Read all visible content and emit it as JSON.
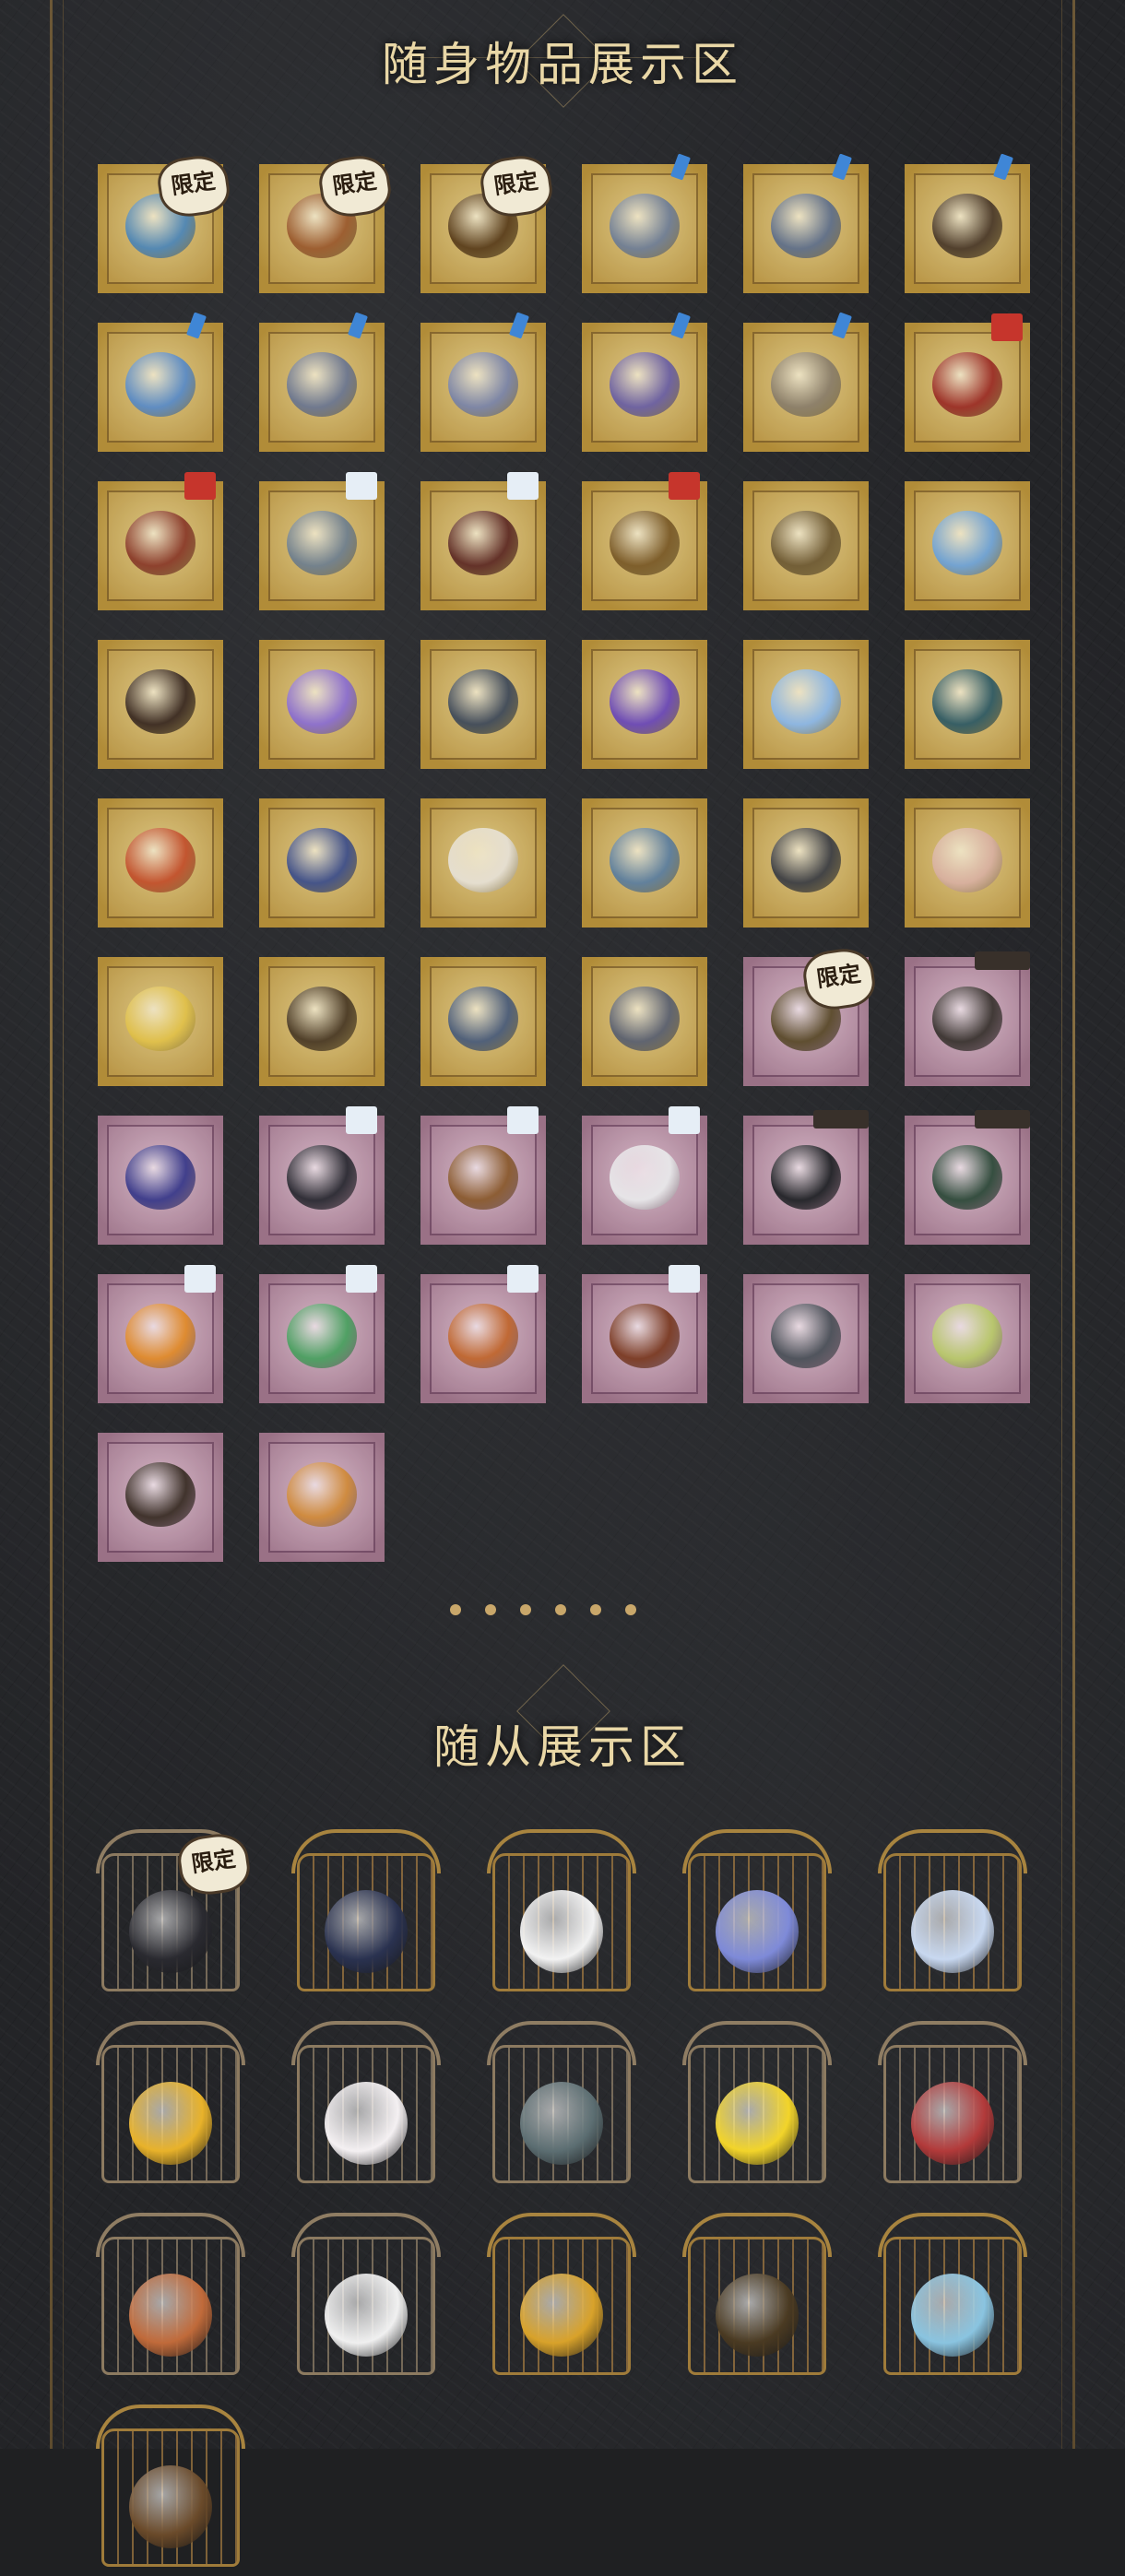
{
  "sections": {
    "carry_items": {
      "title": "随身物品展示区"
    },
    "followers": {
      "title": "随从展示区"
    }
  },
  "labels": {
    "limited": "限定"
  },
  "colors": {
    "gold_stamp": "#c6a64e",
    "purple_stamp": "#b78fa6",
    "title_text": "#e9d7a6",
    "accent_dot": "#c9a76a"
  },
  "stamps": [
    {
      "tier": "gold",
      "badge": "限定",
      "color": "#4e86b6",
      "icon": "bird-icon"
    },
    {
      "tier": "gold",
      "badge": "限定",
      "color": "#9a5a2e",
      "icon": "scroll-icon"
    },
    {
      "tier": "gold",
      "badge": "限定",
      "color": "#5a3e1c",
      "icon": "trophy-icon"
    },
    {
      "tier": "gold",
      "badge": "",
      "tag": "blue",
      "color": "#6f7e96",
      "icon": "mask-icon"
    },
    {
      "tier": "gold",
      "badge": "",
      "tag": "blue",
      "color": "#5f6f8a",
      "icon": "flower-icon"
    },
    {
      "tier": "gold",
      "badge": "",
      "tag": "blue",
      "color": "#4b3a2a",
      "icon": "dragon-icon"
    },
    {
      "tier": "gold",
      "badge": "",
      "tag": "blue",
      "color": "#5a8bc6",
      "icon": "moon-icon"
    },
    {
      "tier": "gold",
      "badge": "",
      "tag": "blue",
      "color": "#6b7690",
      "icon": "gear-icon"
    },
    {
      "tier": "gold",
      "badge": "",
      "tag": "blue",
      "color": "#7a84a8",
      "icon": "shield-icon"
    },
    {
      "tier": "gold",
      "badge": "",
      "tag": "blue",
      "color": "#6a5fa3",
      "icon": "crystal-icon"
    },
    {
      "tier": "gold",
      "badge": "",
      "tag": "blue",
      "color": "#8a7e6a",
      "icon": "bow-icon"
    },
    {
      "tier": "gold",
      "badge": "",
      "tag": "red",
      "color": "#9b2e26",
      "icon": "shrine-icon"
    },
    {
      "tier": "gold",
      "badge": "",
      "tag": "red",
      "color": "#8a3b2a",
      "icon": "doll-icon"
    },
    {
      "tier": "gold",
      "badge": "",
      "tag": "white",
      "color": "#6f7f8e",
      "icon": "sword-icon"
    },
    {
      "tier": "gold",
      "badge": "",
      "tag": "white",
      "color": "#5e2b25",
      "icon": "book-icon"
    },
    {
      "tier": "gold",
      "badge": "",
      "tag": "red",
      "color": "#7a5a28",
      "icon": "key-icon"
    },
    {
      "tier": "gold",
      "badge": "",
      "color": "#6e5a34",
      "icon": "horn-icon"
    },
    {
      "tier": "gold",
      "badge": "",
      "color": "#6ea2d6",
      "icon": "ice-icon"
    },
    {
      "tier": "gold",
      "badge": "",
      "color": "#3a2a22",
      "icon": "brush-icon"
    },
    {
      "tier": "gold",
      "badge": "",
      "color": "#8b6ed0",
      "icon": "heart-icon"
    },
    {
      "tier": "gold",
      "badge": "",
      "color": "#3f4a5a",
      "icon": "anchor-icon"
    },
    {
      "tier": "gold",
      "badge": "",
      "color": "#6a48b8",
      "icon": "orb-icon"
    },
    {
      "tier": "gold",
      "badge": "",
      "color": "#8ab6e6",
      "icon": "snowflake-icon"
    },
    {
      "tier": "gold",
      "badge": "",
      "color": "#2f5a64",
      "icon": "tail-icon"
    },
    {
      "tier": "gold",
      "badge": "",
      "color": "#c2502c",
      "icon": "flame-icon"
    },
    {
      "tier": "gold",
      "badge": "",
      "color": "#3e4f8a",
      "icon": "gauntlet-icon"
    },
    {
      "tier": "gold",
      "badge": "",
      "color": "#e6e0d4",
      "icon": "rose-icon"
    },
    {
      "tier": "gold",
      "badge": "",
      "color": "#5c7e9e",
      "icon": "rock-icon"
    },
    {
      "tier": "gold",
      "badge": "",
      "color": "#3c3e44",
      "icon": "kettle-icon"
    },
    {
      "tier": "gold",
      "badge": "",
      "color": "#d8b0a0",
      "icon": "branch-icon"
    },
    {
      "tier": "gold",
      "badge": "",
      "color": "#e0c04a",
      "icon": "bouquet-icon"
    },
    {
      "tier": "gold",
      "badge": "",
      "color": "#4a3a26",
      "icon": "lantern-icon"
    },
    {
      "tier": "gold",
      "badge": "",
      "color": "#4a5c7a",
      "icon": "ship-icon"
    },
    {
      "tier": "gold",
      "badge": "",
      "color": "#5a6070",
      "icon": "scissors-icon"
    },
    {
      "tier": "purple",
      "badge": "限定",
      "color": "#5a4a2a",
      "icon": "chest-icon"
    },
    {
      "tier": "purple",
      "badge": "",
      "tag": "wide",
      "color": "#3a3430",
      "icon": "camera-icon"
    },
    {
      "tier": "purple",
      "badge": "",
      "color": "#3a3a8a",
      "icon": "globe-icon"
    },
    {
      "tier": "purple",
      "badge": "",
      "tag": "white",
      "color": "#2a2a32",
      "icon": "coat-icon"
    },
    {
      "tier": "purple",
      "badge": "",
      "tag": "white",
      "color": "#8a5a2e",
      "icon": "box-icon"
    },
    {
      "tier": "purple",
      "badge": "",
      "tag": "white",
      "color": "#e8e8ea",
      "icon": "cloth-icon"
    },
    {
      "tier": "purple",
      "badge": "",
      "tag": "wide",
      "color": "#202226",
      "icon": "case-icon"
    },
    {
      "tier": "purple",
      "badge": "",
      "tag": "wide",
      "color": "#2e4a3a",
      "icon": "notebook-icon"
    },
    {
      "tier": "purple",
      "badge": "",
      "tag": "white",
      "color": "#e08a2a",
      "icon": "jar-icon"
    },
    {
      "tier": "purple",
      "badge": "",
      "tag": "white",
      "color": "#4aa060",
      "icon": "beads-icon"
    },
    {
      "tier": "purple",
      "badge": "",
      "tag": "white",
      "color": "#c0662e",
      "icon": "cat-icon"
    },
    {
      "tier": "purple",
      "badge": "",
      "tag": "white",
      "color": "#7a3a22",
      "icon": "treasure-icon"
    },
    {
      "tier": "purple",
      "badge": "",
      "color": "#4a5058",
      "icon": "fish-icon"
    },
    {
      "tier": "purple",
      "badge": "",
      "color": "#b8c86a",
      "icon": "glasses-icon"
    },
    {
      "tier": "purple",
      "badge": "",
      "color": "#3a2e26",
      "icon": "boot-icon"
    },
    {
      "tier": "purple",
      "badge": "",
      "color": "#d08a3a",
      "icon": "frame-icon"
    }
  ],
  "pets": [
    {
      "cage": "gray",
      "badge": "限定",
      "color": "#2a2a30",
      "icon": "reaper-icon"
    },
    {
      "cage": "gold",
      "badge": "",
      "color": "#2a3250",
      "icon": "p5-mascot-icon"
    },
    {
      "cage": "gold",
      "badge": "",
      "color": "#f2f2f2",
      "icon": "panda-icon"
    },
    {
      "cage": "gold",
      "badge": "",
      "color": "#7e8ad8",
      "icon": "jellyfish-icon"
    },
    {
      "cage": "gold",
      "badge": "",
      "color": "#c8d8f0",
      "icon": "butterfly-icon"
    },
    {
      "cage": "gray",
      "badge": "",
      "color": "#e8b22a",
      "icon": "duck-icon"
    },
    {
      "cage": "gray",
      "badge": "",
      "color": "#f4f0f2",
      "icon": "kitty-icon"
    },
    {
      "cage": "gray",
      "badge": "",
      "color": "#5c6e72",
      "icon": "cat-demon-icon"
    },
    {
      "cage": "gray",
      "badge": "",
      "color": "#f2d42a",
      "icon": "chick-icon"
    },
    {
      "cage": "gray",
      "badge": "",
      "color": "#b23a3a",
      "icon": "moth-icon"
    },
    {
      "cage": "gray",
      "badge": "",
      "color": "#c06a3a",
      "icon": "king-cat-icon"
    },
    {
      "cage": "gray",
      "badge": "",
      "color": "#f0f0f0",
      "icon": "panda-icon"
    },
    {
      "cage": "gold",
      "badge": "",
      "color": "#d8a22a",
      "icon": "gramophone-icon"
    },
    {
      "cage": "gold",
      "badge": "",
      "color": "#4a3a22",
      "icon": "clock-icon"
    },
    {
      "cage": "gold",
      "badge": "",
      "color": "#8ac4e0",
      "icon": "wing-icon"
    },
    {
      "cage": "gold",
      "badge": "",
      "color": "#6a4a2a",
      "icon": "fan-icon"
    }
  ]
}
